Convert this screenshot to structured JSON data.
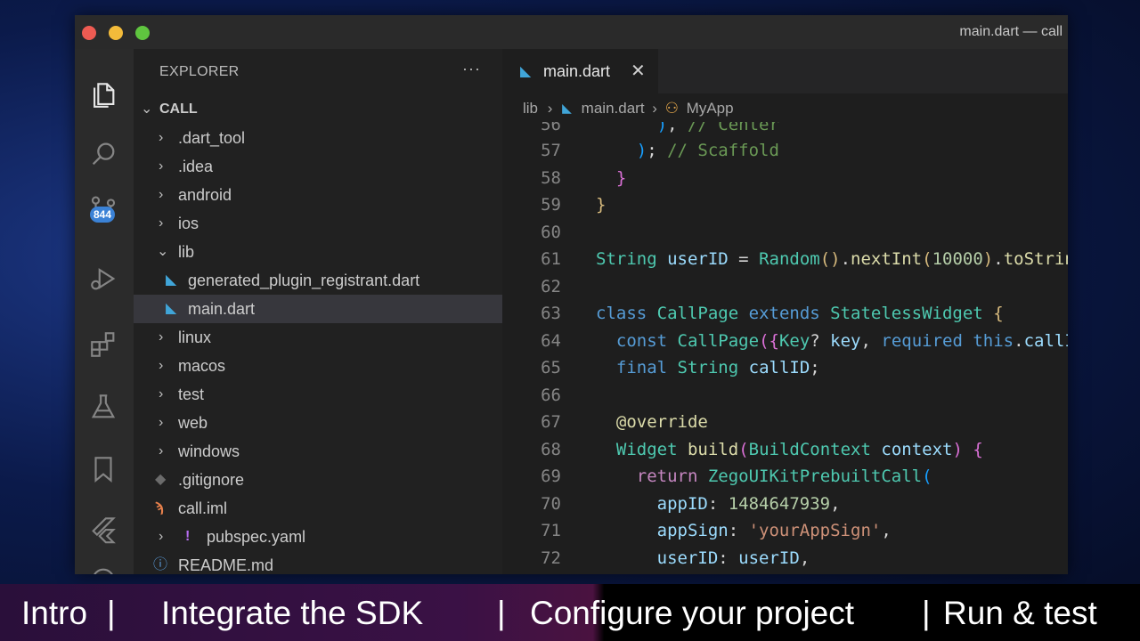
{
  "window": {
    "title": "main.dart — call"
  },
  "activity": {
    "badge": "844"
  },
  "explorer": {
    "header": "EXPLORER",
    "more": "···",
    "root": "CALL",
    "items": [
      {
        "label": ".dart_tool",
        "kind": "folder"
      },
      {
        "label": ".idea",
        "kind": "folder"
      },
      {
        "label": "android",
        "kind": "folder"
      },
      {
        "label": "ios",
        "kind": "folder"
      },
      {
        "label": "lib",
        "kind": "folder-open"
      },
      {
        "label": "generated_plugin_registrant.dart",
        "kind": "dart"
      },
      {
        "label": "main.dart",
        "kind": "dart"
      },
      {
        "label": "linux",
        "kind": "folder"
      },
      {
        "label": "macos",
        "kind": "folder"
      },
      {
        "label": "test",
        "kind": "folder"
      },
      {
        "label": "web",
        "kind": "folder"
      },
      {
        "label": "windows",
        "kind": "folder"
      },
      {
        "label": ".gitignore",
        "kind": "git"
      },
      {
        "label": "call.iml",
        "kind": "xml"
      },
      {
        "label": "pubspec.yaml",
        "kind": "yaml"
      },
      {
        "label": "README.md",
        "kind": "info"
      }
    ]
  },
  "editor": {
    "tab": "main.dart",
    "breadcrumb": [
      "lib",
      "main.dart",
      "MyApp"
    ],
    "lines": [
      "56",
      "57",
      "58",
      "59",
      "60",
      "61",
      "62",
      "63",
      "64",
      "65",
      "66",
      "67",
      "68",
      "69",
      "70",
      "71",
      "72"
    ]
  },
  "caption": {
    "intro": "Intro",
    "integrate": "Integrate the SDK",
    "configure": "Configure your project",
    "run": "Run & test",
    "sep": "|"
  }
}
